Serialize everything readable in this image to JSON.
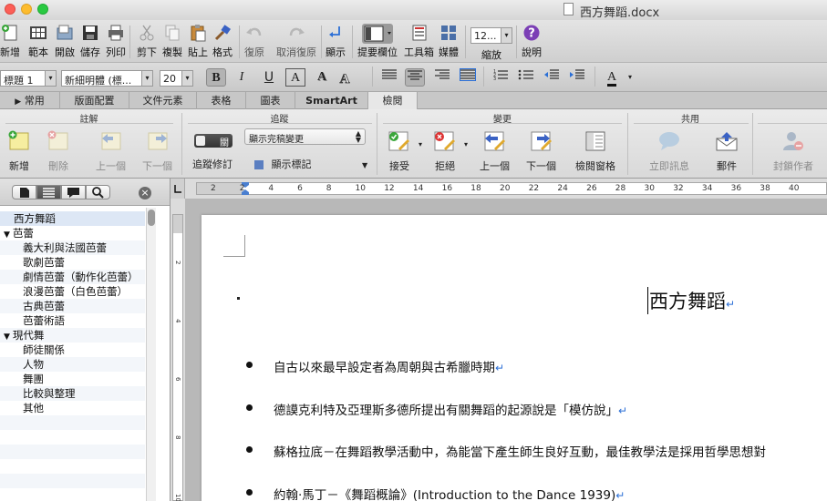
{
  "window": {
    "title": "西方舞蹈.docx"
  },
  "toolbar": {
    "new": "新增",
    "template": "範本",
    "open": "開啟",
    "save": "儲存",
    "print": "列印",
    "cut": "剪下",
    "copy": "複製",
    "paste": "貼上",
    "format": "格式",
    "undo": "復原",
    "redo": "取消復原",
    "show": "顯示",
    "sidebar": "提要欄位",
    "toolbox": "工具箱",
    "media": "媒體",
    "zoom_value": "12...",
    "zoom": "縮放",
    "help": "說明"
  },
  "format": {
    "style": "標題 1",
    "font": "新細明體 (標...",
    "size": "20",
    "bold": "B",
    "italic": "I",
    "underline": "U",
    "outline": "A",
    "shadow": "A",
    "font_color": "A"
  },
  "tabs": [
    "常用",
    "版面配置",
    "文件元素",
    "表格",
    "圖表",
    "SmartArt",
    "檢閱"
  ],
  "ribbon": {
    "groups": {
      "comments": "註解",
      "tracking": "追蹤",
      "changes": "變更",
      "share": "共用"
    },
    "comments": {
      "new": "新增",
      "delete": "刪除",
      "previous": "上一個",
      "next": "下一個"
    },
    "tracking": {
      "toggle": "關",
      "track_changes": "追蹤修訂",
      "markup_select": "顯示完稿變更",
      "show_markup": "顯示標記"
    },
    "changes": {
      "accept": "接受",
      "reject": "拒絕",
      "previous": "上一個",
      "next": "下一個",
      "review_pane": "檢閱窗格"
    },
    "share": {
      "im": "立即訊息",
      "mail": "郵件",
      "block_authors": "封鎖作者"
    }
  },
  "navigation": {
    "items": [
      {
        "label": "西方舞蹈",
        "level": 0,
        "toggle": ""
      },
      {
        "label": "芭蕾",
        "level": 0,
        "toggle": "▼"
      },
      {
        "label": "義大利與法國芭蕾",
        "level": 2,
        "toggle": ""
      },
      {
        "label": "歌劇芭蕾",
        "level": 2,
        "toggle": ""
      },
      {
        "label": "劇情芭蕾（動作化芭蕾）",
        "level": 2,
        "toggle": ""
      },
      {
        "label": "浪漫芭蕾（白色芭蕾）",
        "level": 2,
        "toggle": ""
      },
      {
        "label": "古典芭蕾",
        "level": 2,
        "toggle": ""
      },
      {
        "label": "芭蕾術語",
        "level": 2,
        "toggle": ""
      },
      {
        "label": "現代舞",
        "level": 0,
        "toggle": "▼"
      },
      {
        "label": "師徒關係",
        "level": 2,
        "toggle": ""
      },
      {
        "label": "人物",
        "level": 2,
        "toggle": ""
      },
      {
        "label": "舞團",
        "level": 2,
        "toggle": ""
      },
      {
        "label": "比較與整理",
        "level": 2,
        "toggle": ""
      },
      {
        "label": "其他",
        "level": 2,
        "toggle": ""
      }
    ]
  },
  "ruler": {
    "h_labels": [
      "2",
      "2",
      "4",
      "6",
      "8",
      "10",
      "12",
      "14",
      "16",
      "18",
      "20",
      "22",
      "24",
      "26",
      "28",
      "30",
      "32",
      "34",
      "36",
      "38",
      "40"
    ],
    "v_labels": [
      "2",
      "4",
      "6",
      "8",
      "10"
    ]
  },
  "document": {
    "title": "西方舞蹈",
    "pilcrow": "↵",
    "bullets": [
      "自古以來最早設定者為周朝與古希臘時期",
      "德謨克利特及亞理斯多德所提出有關舞蹈的起源說是「模仿說」",
      "蘇格拉底－在舞蹈教學活動中，為能當下產生師生良好互動，最佳教學法是採用哲學思想對",
      "約翰‧馬丁－《舞蹈概論》(Introduction to the Dance 1939)"
    ]
  },
  "colors": {
    "accent": "#2b6fd6",
    "ribbon_bg": "#e4e4e4",
    "workspace": "#b8b8b8"
  }
}
